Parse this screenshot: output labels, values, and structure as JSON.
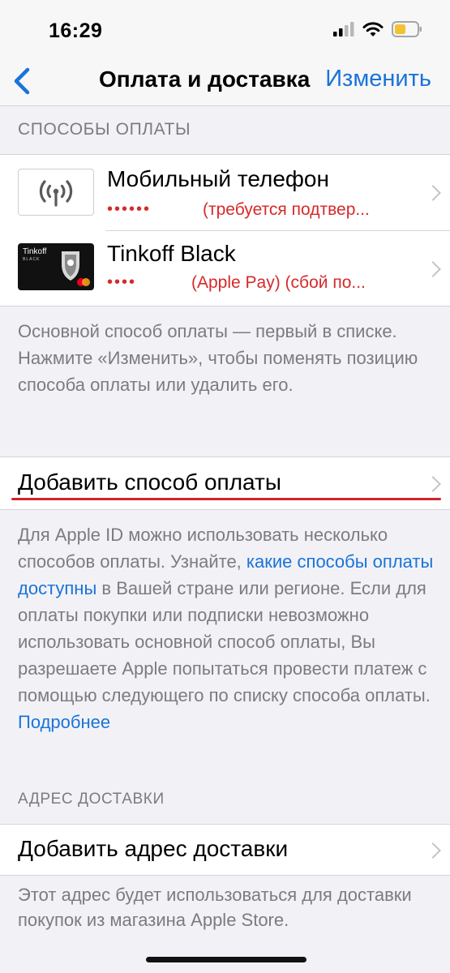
{
  "status_bar": {
    "time": "16:29"
  },
  "nav": {
    "title": "Оплата и доставка",
    "edit_label": "Изменить"
  },
  "payment_section": {
    "header": "СПОСОБЫ ОПЛАТЫ",
    "methods": [
      {
        "icon": "cell-tower-icon",
        "title": "Мобильный телефон",
        "masked": "••••••",
        "status": "(требуется подтвер..."
      },
      {
        "icon": "tinkoff-card-icon",
        "title": "Tinkoff Black",
        "masked": "••••",
        "status": "(Apple Pay) (сбой по...",
        "card_brand": "Tinkoff",
        "card_sub": "BLACK"
      }
    ],
    "footer": "Основной способ оплаты — первый в списке. Нажмите «Изменить», чтобы поменять позицию способа оплаты или удалить его."
  },
  "add_payment": {
    "label": "Добавить способ оплаты",
    "footer_part1": "Для Apple ID можно использовать несколько способов оплаты. Узнайте, ",
    "footer_link": "какие способы оплаты доступны",
    "footer_part2": " в Вашей стране или регионе. Если для оплаты покупки или подписки невозможно использовать основной способ оплаты, Вы разрешаете Apple попытаться провести платеж с помощью следующего по списку способа оплаты. ",
    "footer_more": "Подробнее"
  },
  "shipping_section": {
    "header": "АДРЕС ДОСТАВКИ",
    "add_label": "Добавить адрес доставки",
    "footer": "Этот адрес будет использоваться для доставки покупок из магазина Apple Store."
  },
  "colors": {
    "accent": "#1a73d9",
    "error": "#d62a2a",
    "underline": "#d0242f"
  }
}
